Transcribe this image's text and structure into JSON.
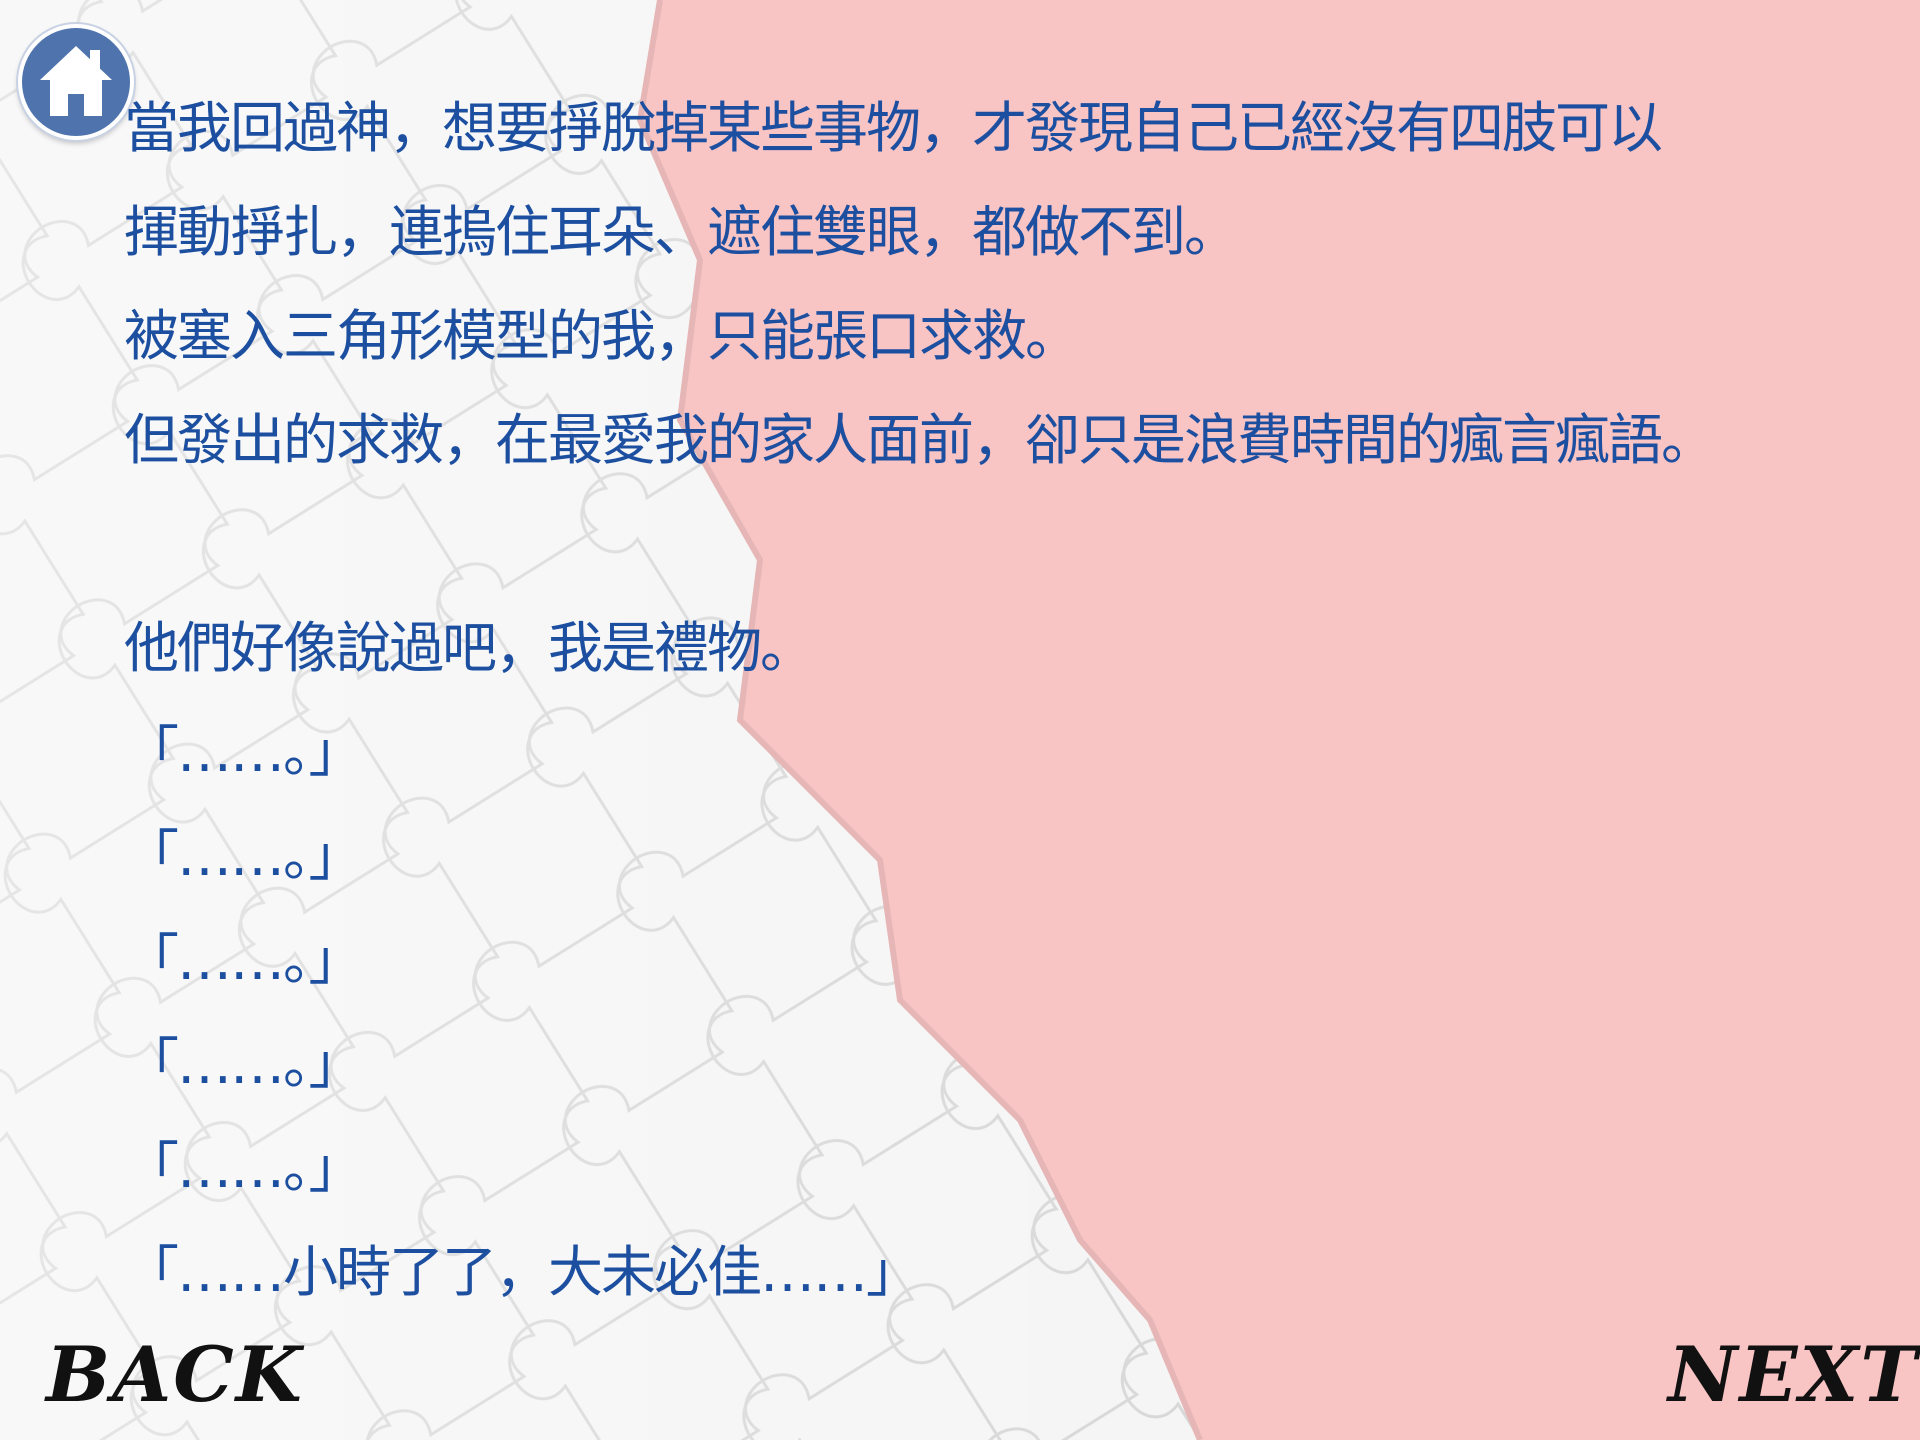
{
  "colors": {
    "background_pink": "#f8c4c4",
    "puzzle_white": "#f4f4f4",
    "text_blue": "#1d4fa0",
    "home_button_blue": "#4f74ad",
    "nav_text": "#111111"
  },
  "home": {
    "icon": "home-icon"
  },
  "story": {
    "lines": [
      "當我回過神，想要掙脫掉某些事物，才發現自己已經沒有四肢可以",
      "揮動掙扎，連摀住耳朵、遮住雙眼，都做不到。",
      "被塞入三角形模型的我，只能張口求救。",
      "但發出的求救，在最愛我的家人面前，卻只是浪費時間的瘋言瘋語。"
    ],
    "lines2": [
      "他們好像說過吧，我是禮物。",
      "「……。」",
      "「……。」",
      "「……。」",
      "「……。」",
      "「……。」",
      "「……小時了了，大未必佳……」"
    ]
  },
  "nav": {
    "back_label": "BACK",
    "next_label": "NEXT"
  }
}
